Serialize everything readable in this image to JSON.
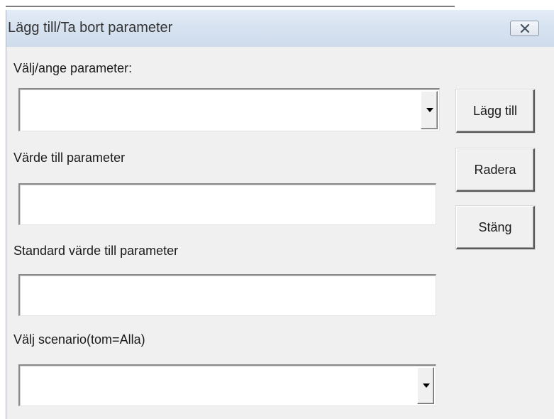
{
  "window": {
    "title": "Lägg till/Ta bort parameter",
    "close_icon": "close-x-icon"
  },
  "form": {
    "parameter_label": "Välj/ange parameter:",
    "parameter_value": "",
    "value_label": "Värde till parameter",
    "value_value": "",
    "default_label": "Standard värde till parameter",
    "default_value": "",
    "scenario_label": "Välj scenario(tom=Alla)",
    "scenario_value": ""
  },
  "buttons": {
    "add": "Lägg till",
    "delete": "Radera",
    "close": "Stäng"
  }
}
